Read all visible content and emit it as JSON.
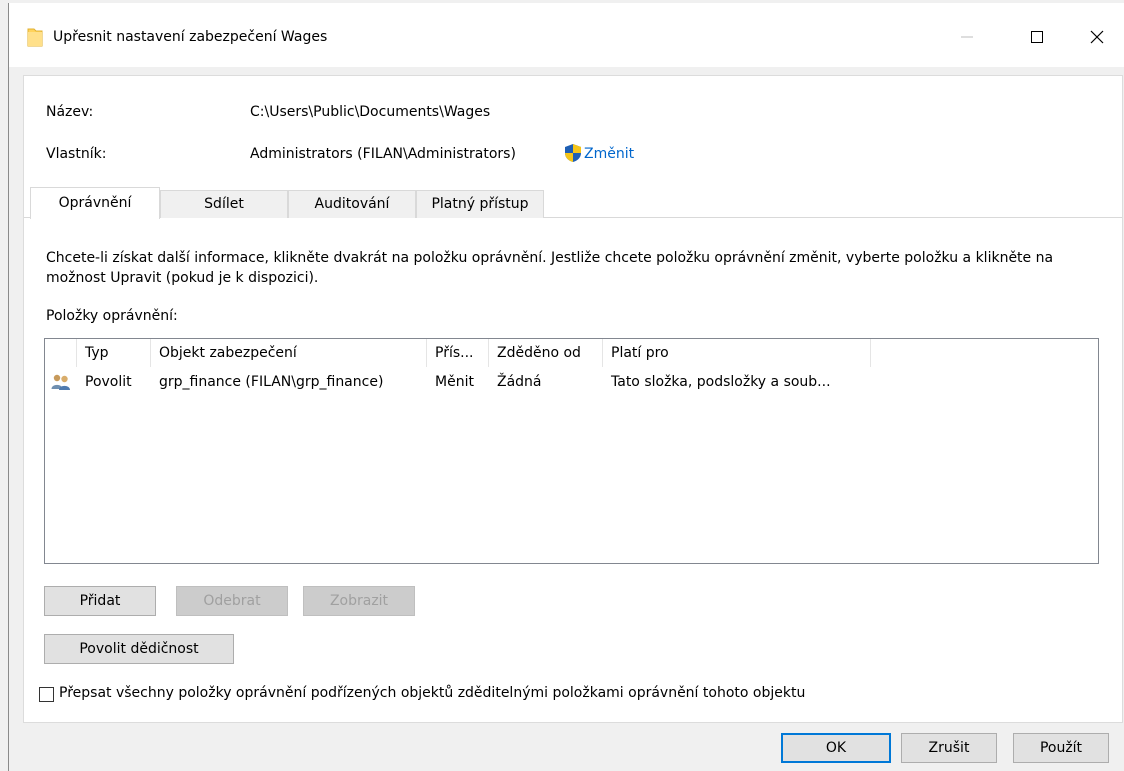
{
  "window": {
    "title": "Upřesnit nastavení zabezpečení Wages"
  },
  "fields": {
    "name_label": "Název:",
    "name_value": "C:\\Users\\Public\\Documents\\Wages",
    "owner_label": "Vlastník:",
    "owner_value": "Administrators (FILAN\\Administrators)",
    "change_link": "Změnit"
  },
  "tabs": [
    {
      "label": "Oprávnění",
      "active": true
    },
    {
      "label": "Sdílet",
      "active": false
    },
    {
      "label": "Auditování",
      "active": false
    },
    {
      "label": "Platný přístup",
      "active": false
    }
  ],
  "permissions": {
    "info": "Chcete-li získat další informace, klikněte dvakrát na položku oprávnění. Jestliže chcete položku oprávnění změnit, vyberte položku a klikněte na možnost Upravit (pokud je k dispozici).",
    "list_label": "Položky oprávnění:",
    "columns": [
      "Typ",
      "Objekt zabezpečení",
      "Přís...",
      "Zděděno od",
      "Platí pro"
    ],
    "rows": [
      {
        "icon": "users-icon",
        "type": "Povolit",
        "principal": "grp_finance (FILAN\\grp_finance)",
        "access": "Měnit",
        "inherited_from": "Žádná",
        "applies_to": "Tato složka, podsložky a soub..."
      }
    ]
  },
  "buttons": {
    "add": "Přidat",
    "remove": "Odebrat",
    "view": "Zobrazit",
    "enable_inheritance": "Povolit dědičnost",
    "ok": "OK",
    "cancel": "Zrušit",
    "apply": "Použít"
  },
  "checkbox": {
    "label": "Přepsat všechny položky oprávnění podřízených objektů zděditelnými položkami oprávnění tohoto objektu",
    "checked": false
  },
  "colors": {
    "link": "#0066cc",
    "default_button_border": "#0078d7",
    "folder": "#ffd35c"
  }
}
